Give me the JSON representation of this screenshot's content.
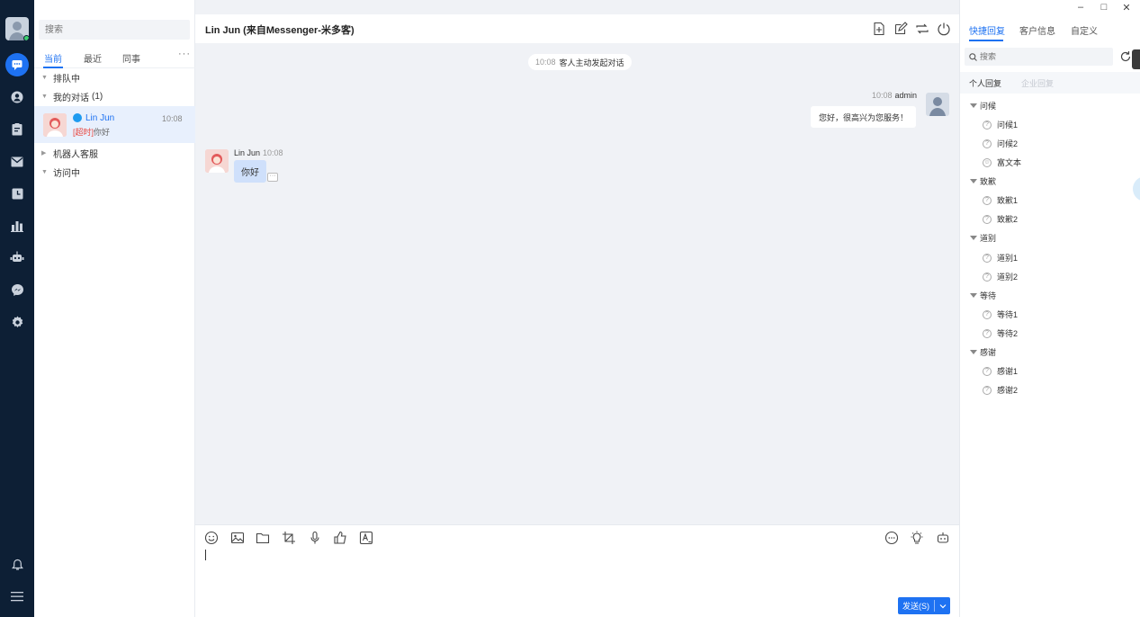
{
  "app": {
    "left_nav": {
      "items": [
        {
          "name": "chat-icon",
          "active": true
        },
        {
          "name": "contact-icon"
        },
        {
          "name": "ticket-icon"
        },
        {
          "name": "mail-icon"
        },
        {
          "name": "history-icon"
        },
        {
          "name": "stats-icon"
        },
        {
          "name": "robot-icon"
        },
        {
          "name": "messenger-icon"
        },
        {
          "name": "settings-icon"
        },
        {
          "name": "bell-icon"
        },
        {
          "name": "menu-icon"
        }
      ]
    },
    "conversation_list": {
      "search_placeholder": "搜索",
      "tabs": [
        "当前",
        "最近",
        "同事"
      ],
      "more": "···",
      "groups": {
        "queue": "排队中",
        "mine": "我的对话",
        "mine_count": "(1)",
        "bot": "机器人客服",
        "visiting": "访问中"
      },
      "active_conversation": {
        "name": "Lin Jun",
        "time": "10:08",
        "tag": "[超时]",
        "preview": "你好"
      }
    },
    "chat": {
      "title": "Lin Jun (来自Messenger-米多客)",
      "system_message": {
        "time": "10:08",
        "text": "客人主动发起对话"
      },
      "agent_message": {
        "time": "10:08",
        "sender": "admin",
        "text": "您好，很高兴为您服务！"
      },
      "customer_message": {
        "sender": "Lin Jun",
        "time": "10:08",
        "text": "你好"
      },
      "send_button": "发送(S)"
    },
    "right_panel": {
      "window_controls": [
        "–",
        "□",
        "✕"
      ],
      "tabs": [
        "快捷回复",
        "客户信息",
        "自定义"
      ],
      "search_placeholder": "搜索",
      "sub_tabs": [
        "个人回复",
        "企业回复"
      ],
      "categories": [
        {
          "name": "问候",
          "items": [
            "问候1",
            "问候2",
            "富文本"
          ]
        },
        {
          "name": "致歉",
          "items": [
            "致歉1",
            "致歉2"
          ]
        },
        {
          "name": "道别",
          "items": [
            "道别1",
            "道别2"
          ]
        },
        {
          "name": "等待",
          "items": [
            "等待1",
            "等待2"
          ]
        },
        {
          "name": "感谢",
          "items": [
            "感谢1",
            "感谢2"
          ]
        }
      ]
    },
    "colors": {
      "nav_bg": "#0d1f35",
      "accent": "#1e72f2",
      "chat_bg": "#f0f2f6",
      "customer_bubble": "#cfe0fb",
      "timeout_tag": "#e9473f"
    }
  }
}
